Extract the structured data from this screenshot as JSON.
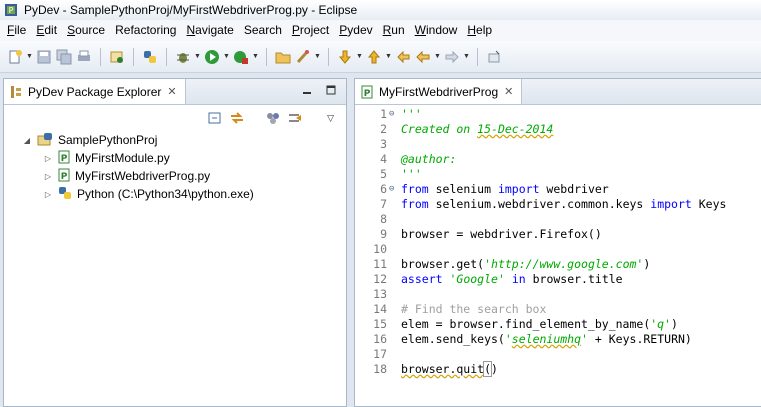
{
  "window": {
    "title": "PyDev - SamplePythonProj/MyFirstWebdriverProg.py - Eclipse"
  },
  "menu": [
    {
      "label": "File",
      "u": "F",
      "rest": "ile"
    },
    {
      "label": "Edit",
      "u": "E",
      "rest": "dit"
    },
    {
      "label": "Source",
      "u": "S",
      "rest": "ource"
    },
    {
      "label": "Refactoring",
      "u": "",
      "rest": "Refactoring"
    },
    {
      "label": "Navigate",
      "u": "N",
      "rest": "avigate"
    },
    {
      "label": "Search",
      "u": "",
      "rest": "Search"
    },
    {
      "label": "Project",
      "u": "P",
      "rest": "roject"
    },
    {
      "label": "Pydev",
      "u": "P",
      "rest": "ydev"
    },
    {
      "label": "Run",
      "u": "R",
      "rest": "un"
    },
    {
      "label": "Window",
      "u": "W",
      "rest": "indow"
    },
    {
      "label": "Help",
      "u": "H",
      "rest": "elp"
    }
  ],
  "explorer": {
    "tab_label": "PyDev Package Explorer",
    "tree": [
      {
        "label": "SamplePythonProj",
        "level": 0,
        "twisty": "expanded",
        "icon": "python-project-icon"
      },
      {
        "label": "MyFirstModule.py",
        "level": 1,
        "twisty": "collapsed",
        "icon": "python-file-icon"
      },
      {
        "label": "MyFirstWebdriverProg.py",
        "level": 1,
        "twisty": "collapsed",
        "icon": "python-file-icon"
      },
      {
        "label": "Python  (C:\\Python34\\python.exe)",
        "level": 1,
        "twisty": "collapsed",
        "icon": "python-interpreter-icon"
      }
    ]
  },
  "editor": {
    "tab_label": "MyFirstWebdriverProg",
    "lines": [
      {
        "n": "1",
        "fold": "⊖",
        "parts": [
          {
            "t": "'''",
            "c": "doc"
          }
        ]
      },
      {
        "n": "2",
        "fold": "",
        "parts": [
          {
            "t": "Created on ",
            "c": "doc"
          },
          {
            "t": "15-Dec-2014",
            "c": "doc squiggle"
          }
        ]
      },
      {
        "n": "3",
        "fold": "",
        "parts": []
      },
      {
        "n": "4",
        "fold": "",
        "parts": [
          {
            "t": "@author:",
            "c": "doc"
          }
        ]
      },
      {
        "n": "5",
        "fold": "",
        "parts": [
          {
            "t": "'''",
            "c": "doc"
          }
        ]
      },
      {
        "n": "6",
        "fold": "⊖",
        "parts": [
          {
            "t": "from",
            "c": "kw"
          },
          {
            "t": " selenium ",
            "c": "plain"
          },
          {
            "t": "import",
            "c": "kw"
          },
          {
            "t": " webdriver",
            "c": "plain"
          }
        ]
      },
      {
        "n": "7",
        "fold": "",
        "parts": [
          {
            "t": "from",
            "c": "kw"
          },
          {
            "t": " selenium.webdriver.common.keys ",
            "c": "plain"
          },
          {
            "t": "import",
            "c": "kw"
          },
          {
            "t": " Keys",
            "c": "plain"
          }
        ]
      },
      {
        "n": "8",
        "fold": "",
        "parts": []
      },
      {
        "n": "9",
        "fold": "",
        "parts": [
          {
            "t": "browser = webdriver.Firefox()",
            "c": "plain"
          }
        ]
      },
      {
        "n": "10",
        "fold": "",
        "parts": []
      },
      {
        "n": "11",
        "fold": "",
        "parts": [
          {
            "t": "browser.get(",
            "c": "plain"
          },
          {
            "t": "'http://www.google.com'",
            "c": "str"
          },
          {
            "t": ")",
            "c": "plain"
          }
        ]
      },
      {
        "n": "12",
        "fold": "",
        "parts": [
          {
            "t": "assert",
            "c": "kw"
          },
          {
            "t": " ",
            "c": "plain"
          },
          {
            "t": "'Google'",
            "c": "str"
          },
          {
            "t": " ",
            "c": "plain"
          },
          {
            "t": "in",
            "c": "kw"
          },
          {
            "t": " browser.title",
            "c": "plain"
          }
        ]
      },
      {
        "n": "13",
        "fold": "",
        "parts": []
      },
      {
        "n": "14",
        "fold": "",
        "parts": [
          {
            "t": "# Find the search box",
            "c": "comment"
          }
        ]
      },
      {
        "n": "15",
        "fold": "",
        "parts": [
          {
            "t": "elem = browser.find_element_by_name(",
            "c": "plain"
          },
          {
            "t": "'q'",
            "c": "str"
          },
          {
            "t": ")",
            "c": "plain"
          }
        ]
      },
      {
        "n": "16",
        "fold": "",
        "parts": [
          {
            "t": "elem.send_keys(",
            "c": "plain"
          },
          {
            "t": "'",
            "c": "str"
          },
          {
            "t": "seleniumhq",
            "c": "str squiggle"
          },
          {
            "t": "'",
            "c": "str"
          },
          {
            "t": " + Keys.RETURN)",
            "c": "plain"
          }
        ]
      },
      {
        "n": "17",
        "fold": "",
        "parts": []
      },
      {
        "n": "18",
        "fold": "",
        "parts": [
          {
            "t": "browser.quit",
            "c": "plain squiggle"
          },
          {
            "t": "(",
            "c": "plain bracket"
          },
          {
            "t": ")",
            "c": "plain"
          }
        ]
      }
    ]
  }
}
